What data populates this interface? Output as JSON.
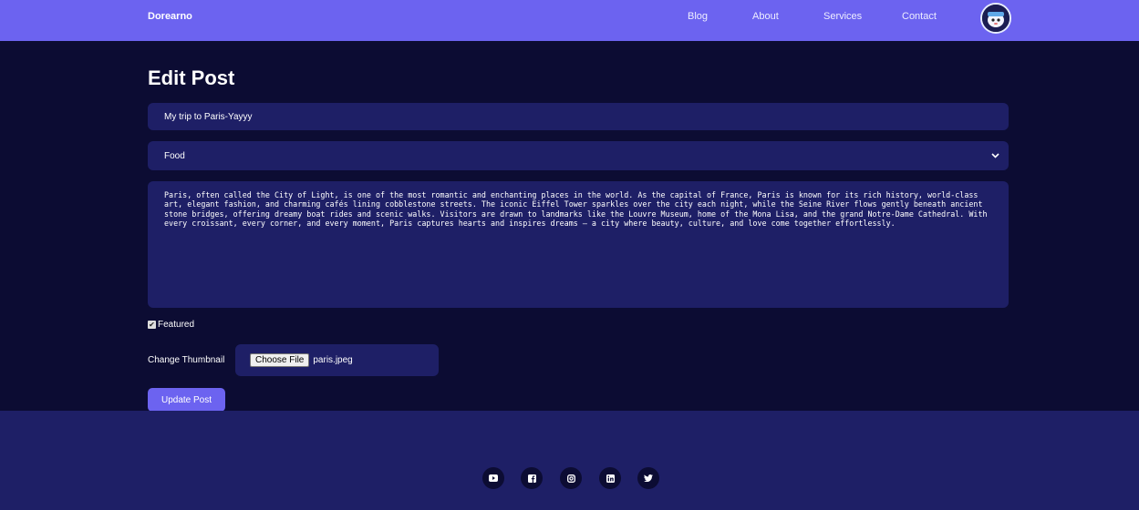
{
  "navbar": {
    "brand": "Dorearno",
    "links": [
      "Blog",
      "About",
      "Services",
      "Contact"
    ]
  },
  "page_title": "Edit Post",
  "form": {
    "title_value": "My trip to Paris-Yayyy",
    "category_value": "Food",
    "body_value": "Paris, often called the City of Light, is one of the most romantic and enchanting places in the world. As the capital of France, Paris is known for its rich history, world-class art, elegant fashion, and charming cafés lining cobblestone streets. The iconic Eiffel Tower sparkles over the city each night, while the Seine River flows gently beneath ancient stone bridges, offering dreamy boat rides and scenic walks. Visitors are drawn to landmarks like the Louvre Museum, home of the Mona Lisa, and the grand Notre-Dame Cathedral. With every croissant, every corner, and every moment, Paris captures hearts and inspires dreams — a city where beauty, culture, and love come together effortlessly.",
    "featured_label": "Featured",
    "featured_checked": true,
    "thumbnail_label": "Change Thumbnail",
    "choose_file_label": "Choose File",
    "file_name": "paris.jpeg",
    "submit_label": "Update Post"
  },
  "footer": {
    "social_icons": [
      "youtube-icon",
      "facebook-icon",
      "instagram-icon",
      "linkedin-icon",
      "twitter-icon"
    ]
  },
  "colors": {
    "accent": "#6c63f0",
    "background": "#0c0c33",
    "field": "#1e1f66"
  }
}
